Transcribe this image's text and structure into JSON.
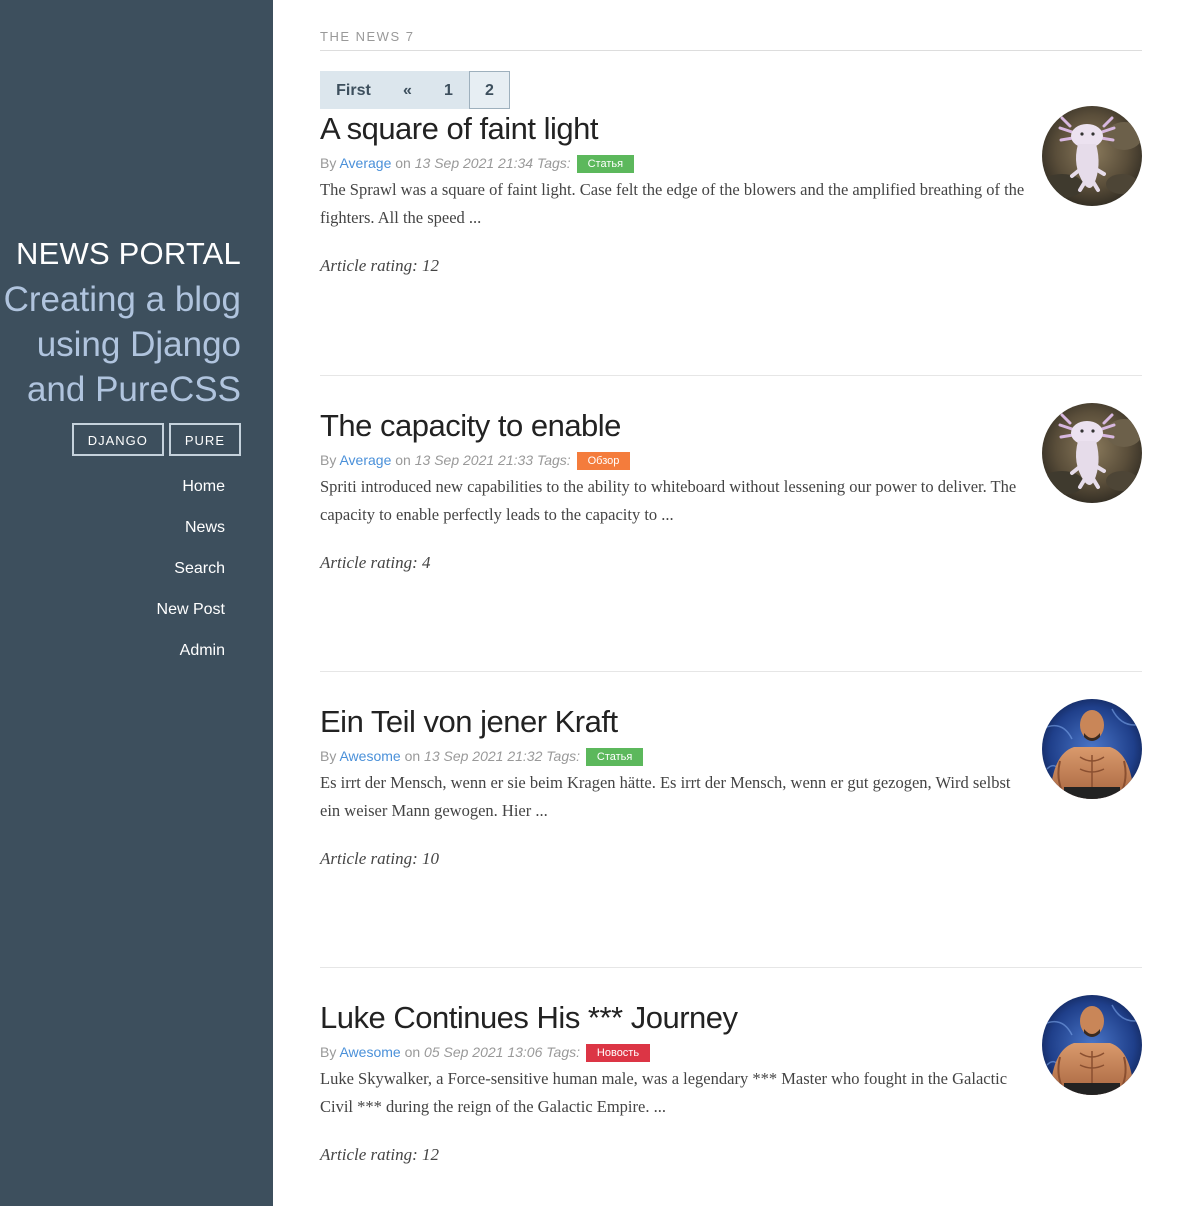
{
  "sidebar": {
    "brand": "NEWS PORTAL",
    "tagline": "Creating a blog using Django and PureCSS",
    "tags": [
      "DJANGO",
      "PURE"
    ],
    "nav": [
      "Home",
      "News",
      "Search",
      "New Post",
      "Admin"
    ]
  },
  "header": {
    "section": "THE NEWS 7"
  },
  "pagination": {
    "first": "First",
    "prev": "«",
    "pages": [
      "1",
      "2"
    ],
    "current": "2"
  },
  "meta_words": {
    "by": "By",
    "on": "on",
    "tags": "Tags:"
  },
  "tag_colors": {
    "Статья": "#5cb85c",
    "Обзор": "#f47c3c",
    "Новость": "#dc3545"
  },
  "posts": [
    {
      "title": "A square of faint light",
      "author": "Average",
      "date": "13 Sep 2021 21:34",
      "tag": "Статья",
      "desc": "The Sprawl was a square of faint light. Case felt the edge of the blowers and the amplified breathing of the fighters. All the speed ...",
      "rating": "Article rating: 12",
      "avatar": "axolotl-avatar"
    },
    {
      "title": "The capacity to enable",
      "author": "Average",
      "date": "13 Sep 2021 21:33",
      "tag": "Обзор",
      "desc": "Spriti introduced new capabilities to the ability to whiteboard without lessening our power to deliver. The capacity to enable perfectly leads to the capacity to ...",
      "rating": "Article rating: 4",
      "avatar": "axolotl-avatar"
    },
    {
      "title": "Ein Teil von jener Kraft",
      "author": "Awesome",
      "date": "13 Sep 2021 21:32",
      "tag": "Статья",
      "desc": "Es irrt der Mensch, wenn er sie beim Kragen hätte. Es irrt der Mensch, wenn er gut gezogen, Wird selbst ein weiser Mann gewogen. Hier ...",
      "rating": "Article rating: 10",
      "avatar": "wrestler-avatar"
    },
    {
      "title": "Luke Continues His *** Journey",
      "author": "Awesome",
      "date": "05 Sep 2021 13:06",
      "tag": "Новость",
      "desc": "Luke Skywalker, a Force-sensitive human male, was a legendary *** Master who fought in the Galactic Civil *** during the reign of the Galactic Empire. ...",
      "rating": "Article rating: 12",
      "avatar": "wrestler-avatar"
    }
  ]
}
